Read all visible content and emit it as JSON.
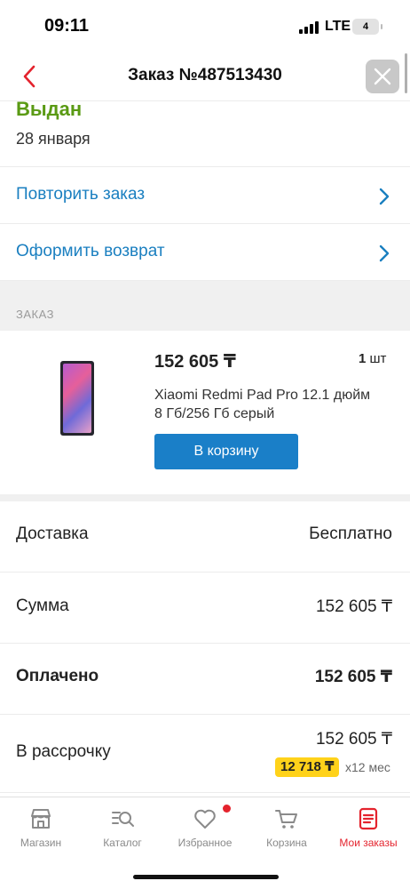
{
  "status_bar": {
    "time": "09:11",
    "network": "LTE",
    "battery": "4"
  },
  "header": {
    "title": "Заказ №487513430"
  },
  "order": {
    "status": "Выдан",
    "date": "28 января"
  },
  "actions": [
    {
      "label": "Повторить заказ"
    },
    {
      "label": "Оформить возврат"
    }
  ],
  "section": {
    "label": "ЗАКАЗ"
  },
  "product": {
    "price": "152 605 ₸",
    "qty_num": "1",
    "qty_unit": " шт",
    "name": "Xiaomi Redmi Pad Pro 12.1 дюйм 8 Гб/256 Гб серый",
    "cart_button": "В корзину"
  },
  "summary": {
    "delivery": {
      "label": "Доставка",
      "value": "Бесплатно"
    },
    "sum": {
      "label": "Сумма",
      "value": "152 605 ₸"
    },
    "paid": {
      "label": "Оплачено",
      "value": "152 605 ₸"
    },
    "installment": {
      "label": "В рассрочку",
      "value": "152 605 ₸",
      "monthly": "12 718 ₸",
      "term": "x12 мес"
    }
  },
  "tabs": [
    {
      "label": "Магазин",
      "icon": "shop-icon"
    },
    {
      "label": "Каталог",
      "icon": "catalog-search-icon"
    },
    {
      "label": "Избранное",
      "icon": "heart-icon"
    },
    {
      "label": "Корзина",
      "icon": "cart-icon"
    },
    {
      "label": "Мои заказы",
      "icon": "orders-icon",
      "active": true
    }
  ],
  "colors": {
    "accent_blue": "#1a7fc0",
    "status_green": "#5a9a14",
    "brand_red": "#e4232d",
    "installment_yellow": "#ffd21a"
  }
}
